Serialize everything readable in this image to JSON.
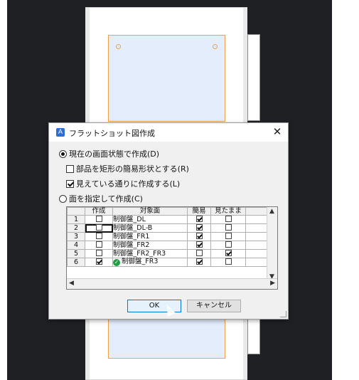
{
  "dialog": {
    "title": "フラットショット図作成",
    "close_glyph": "✕",
    "app_icon_glyph": "A",
    "option_current": "現在の画面状態で作成(D)",
    "option_simplify": "部品を矩形の簡易形状とする(R)",
    "option_visible": "見えている通りに作成する(L)",
    "option_specify": "面を指定して作成(C)",
    "ok_label": "OK",
    "cancel_label": "キャンセル"
  },
  "grid": {
    "headers": [
      "作成",
      "対象面",
      "簡易",
      "見たまま"
    ],
    "rows": [
      {
        "num": "1",
        "create": false,
        "name": "制御盤_DL",
        "simple": true,
        "asis": false
      },
      {
        "num": "2",
        "create": false,
        "name": "制御盤_DL-B",
        "simple": true,
        "asis": false
      },
      {
        "num": "3",
        "create": false,
        "name": "制御盤_FR1",
        "simple": true,
        "asis": false
      },
      {
        "num": "4",
        "create": false,
        "name": "制御盤_FR2",
        "simple": true,
        "asis": false
      },
      {
        "num": "5",
        "create": false,
        "name": "制御盤_FR2_FR3",
        "simple": false,
        "asis": true
      },
      {
        "num": "6",
        "create": true,
        "name": "制御盤_FR3",
        "simple": true,
        "asis": false
      }
    ]
  }
}
